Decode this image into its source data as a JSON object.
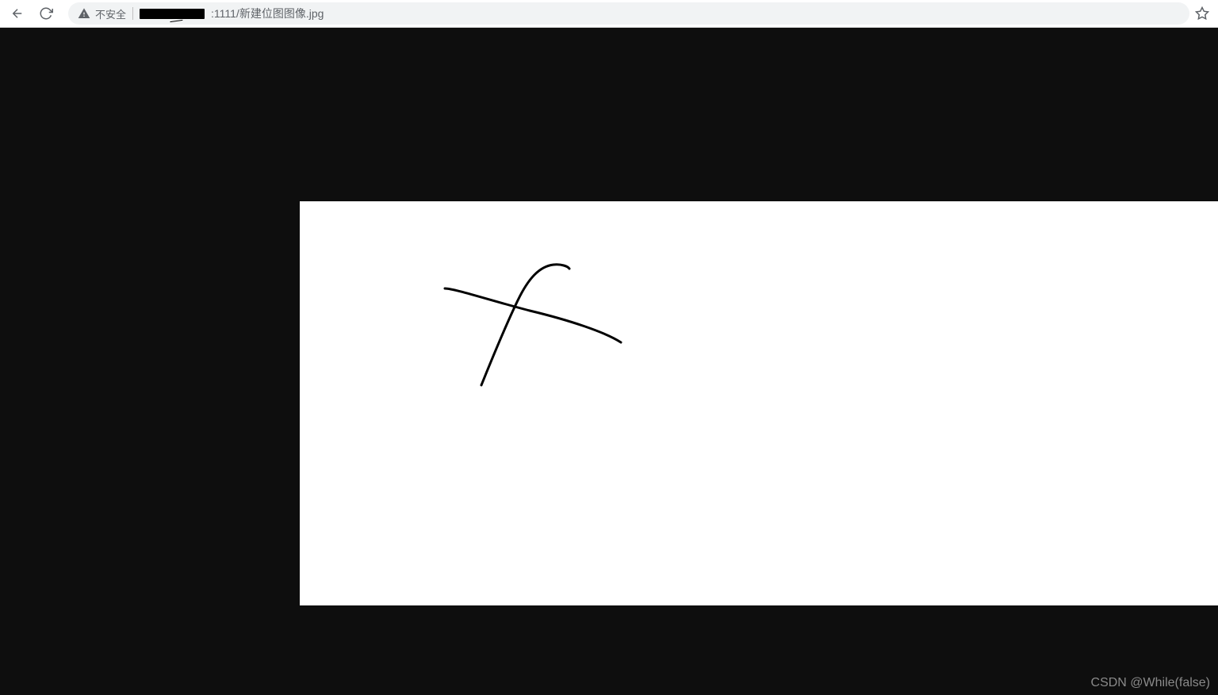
{
  "toolbar": {
    "security_label": "不安全",
    "url_suffix": ":1111/新建位图图像.jpg"
  },
  "content": {
    "background_color": "#0e0e0e",
    "image_background": "#ffffff"
  },
  "watermark": {
    "text": "CSDN @While(false)"
  }
}
